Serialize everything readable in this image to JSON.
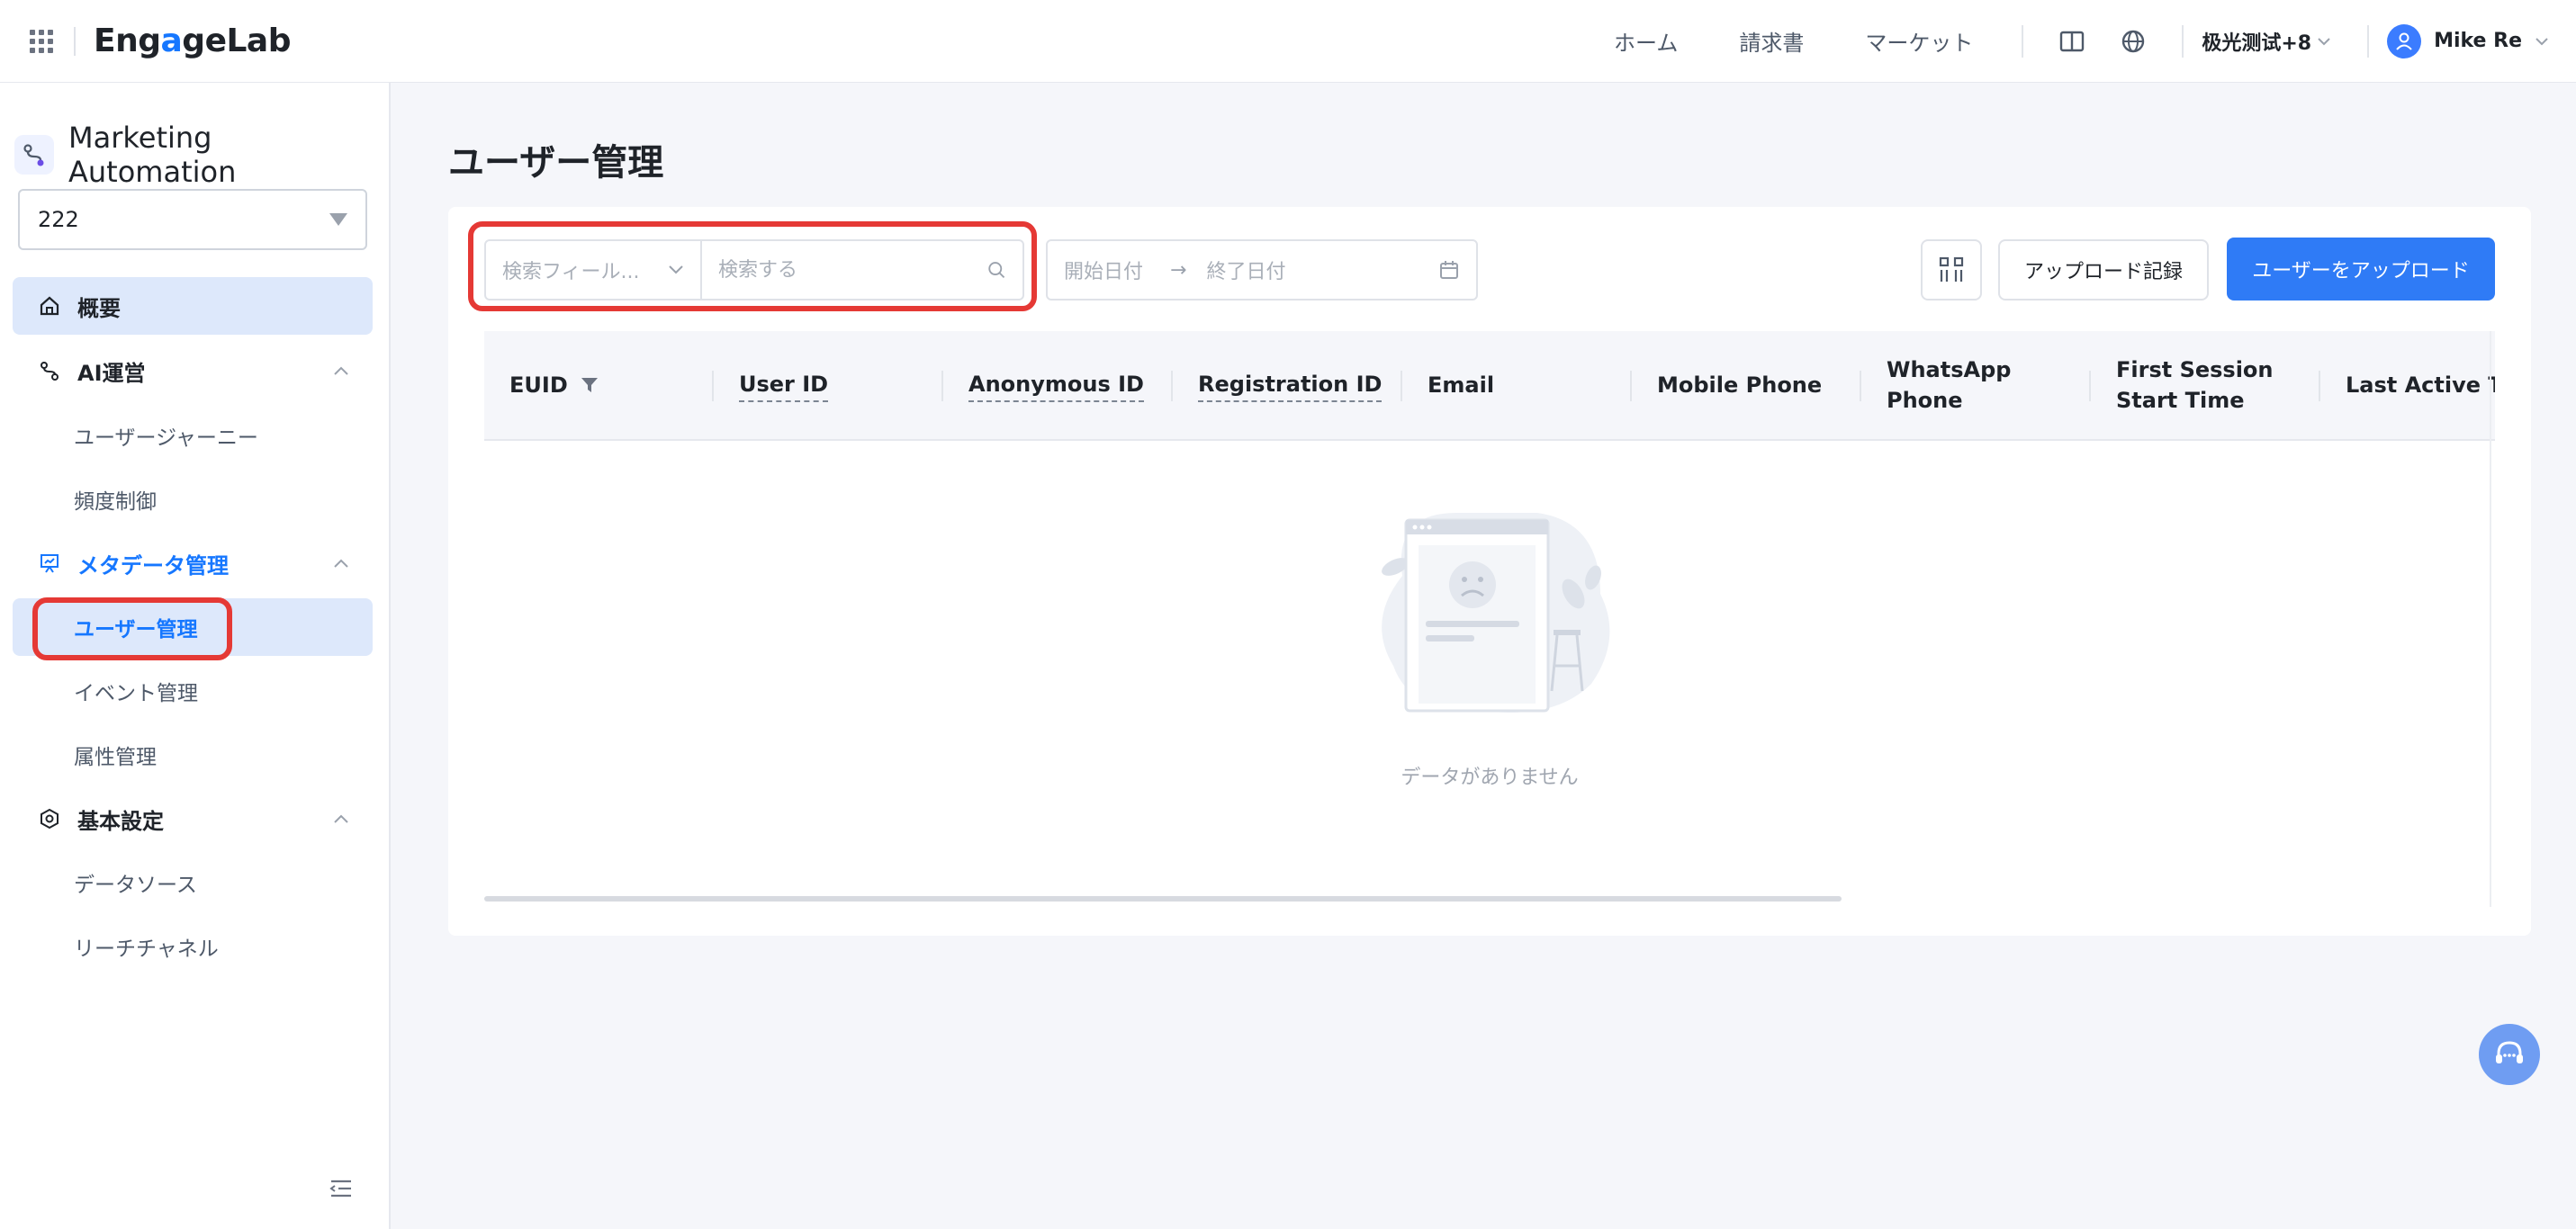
{
  "header": {
    "logo": {
      "prefix": "Eng",
      "accent": "a",
      "suffix": "geLab"
    },
    "nav": [
      "ホーム",
      "請求書",
      "マーケット"
    ],
    "workspace": "极光测试+8",
    "user": "Mike Re"
  },
  "sidebar": {
    "app_name": "Marketing Automation",
    "project": "222",
    "overview": "概要",
    "groups": [
      {
        "label": "AI運営",
        "items": [
          "ユーザージャーニー",
          "頻度制御"
        ]
      },
      {
        "label": "メタデータ管理",
        "items": [
          "ユーザー管理",
          "イベント管理",
          "属性管理"
        ]
      },
      {
        "label": "基本設定",
        "items": [
          "データソース",
          "リーチチャネル"
        ]
      }
    ]
  },
  "main": {
    "title": "ユーザー管理",
    "filters": {
      "field_placeholder": "検索フィール...",
      "search_placeholder": "検索する",
      "start_date": "開始日付",
      "end_date": "終了日付"
    },
    "buttons": {
      "upload_record": "アップロード記録",
      "upload": "ユーザーをアップロード"
    },
    "table": {
      "columns": [
        "EUID",
        "User ID",
        "Anonymous ID",
        "Registration ID",
        "Email",
        "Mobile Phone",
        "WhatsApp Phone",
        "First Session Start Time",
        "Last Active Tir"
      ],
      "empty_text": "データがありません"
    }
  },
  "colors": {
    "primary": "#2f7bf6",
    "annotation": "#e53935",
    "active_bg": "#dde8fb"
  }
}
